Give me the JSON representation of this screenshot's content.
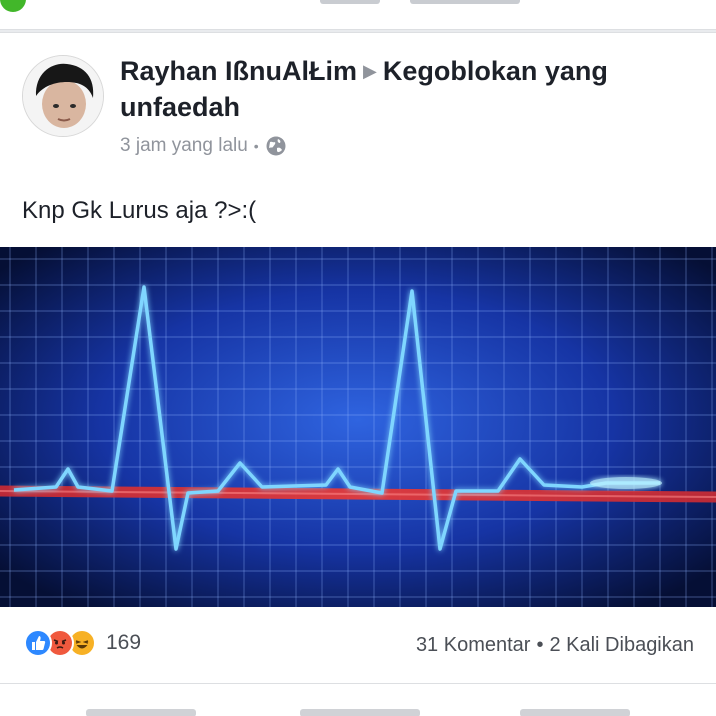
{
  "post": {
    "author": "Rayhan IßnuAlŁim",
    "arrow_glyph": "▶",
    "group": "Kegoblokan yang unfaedah",
    "timestamp": "3 jam yang lalu",
    "separator": "•",
    "privacy_icon": "globe-icon",
    "body": "Knp Gk Lurus aja ?>:("
  },
  "photo": {
    "content": "ecg-heartbeat-monitor",
    "colors": {
      "background": "#0a2a8c",
      "trace": "#7fd6ff",
      "flatline": "#e23a3a"
    }
  },
  "engagement": {
    "reactions": [
      "like",
      "angry",
      "haha"
    ],
    "reaction_count": "169",
    "comments": "31 Komentar",
    "separator": "•",
    "shares": "2 Kali Dibagikan"
  },
  "colors": {
    "like": "#2d88ff",
    "angry": "#f0593e",
    "haha": "#f7b125"
  }
}
